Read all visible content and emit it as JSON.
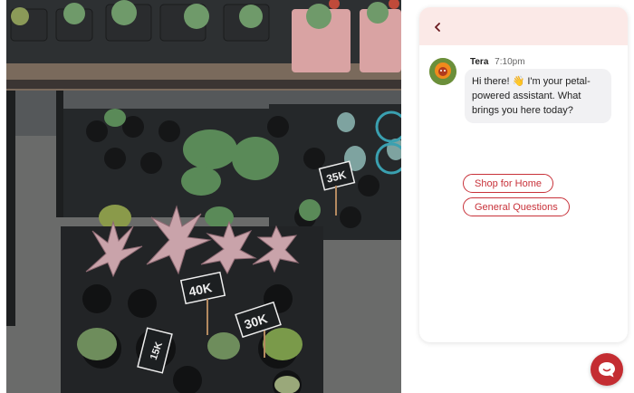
{
  "chat": {
    "sender": "Tera",
    "time": "7:10pm",
    "message": "Hi there! 👋 I'm your petal-powered assistant. What brings you here today?",
    "quick_replies": [
      "Shop for Home",
      "General Questions"
    ]
  },
  "photo": {
    "price_tags": [
      "40K",
      "30K",
      "35K",
      "15K"
    ]
  },
  "colors": {
    "accent": "#c42d32",
    "header_bg": "#fbe9e7",
    "bubble_bg": "#f1f1f3"
  },
  "icons": {
    "back": "chevron-left-icon",
    "launcher": "chat-bubble-icon"
  }
}
